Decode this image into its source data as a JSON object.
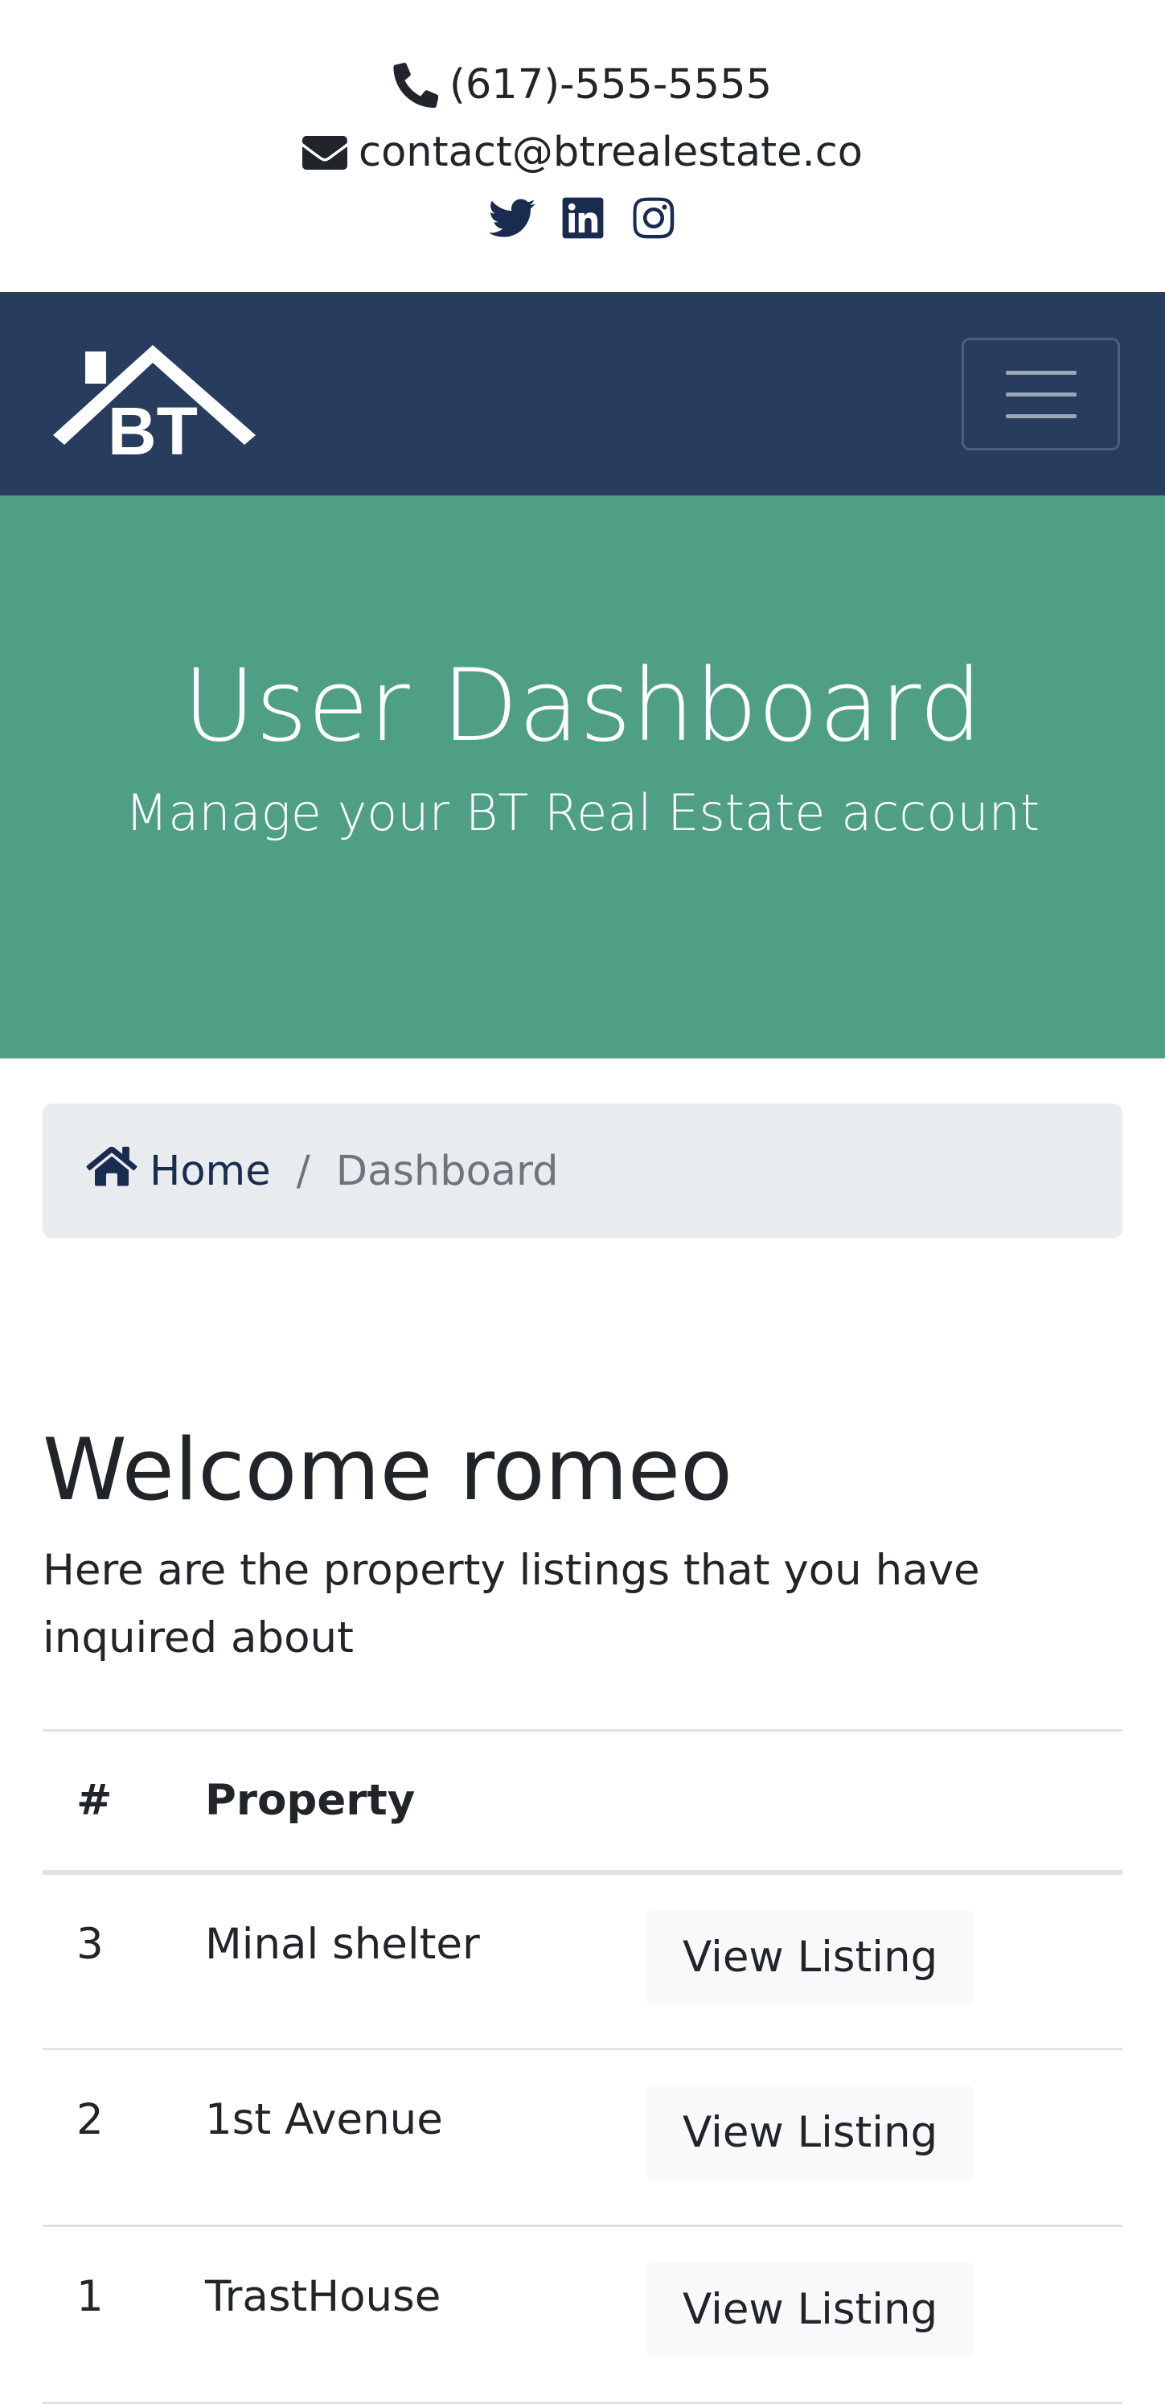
{
  "contact": {
    "phone": "(617)-555-5555",
    "email": "contact@btrealestate.co"
  },
  "colors": {
    "navbar": "#283c5e",
    "hero": "#4f9f87",
    "breadcrumb_bg": "#e9ecef",
    "icon_dark": "#1a2b50"
  },
  "icons": {
    "phone": "phone-icon",
    "email": "envelope-icon",
    "twitter": "twitter-icon",
    "linkedin": "linkedin-icon",
    "instagram": "instagram-icon",
    "home": "home-icon",
    "menu": "hamburger-icon"
  },
  "logo": {
    "text": "BT"
  },
  "hero": {
    "title": "User Dashboard",
    "subtitle": "Manage your BT Real Estate account"
  },
  "breadcrumb": {
    "home": "Home",
    "separator": "/",
    "current": "Dashboard"
  },
  "welcome": {
    "title": "Welcome romeo",
    "text": "Here are the property listings that you have inquired about"
  },
  "table": {
    "headers": [
      "#",
      "Property",
      ""
    ],
    "rows": [
      {
        "id": "3",
        "property": "Minal shelter",
        "action": "View Listing"
      },
      {
        "id": "2",
        "property": "1st Avenue",
        "action": "View Listing"
      },
      {
        "id": "1",
        "property": "TrastHouse",
        "action": "View Listing"
      }
    ]
  }
}
